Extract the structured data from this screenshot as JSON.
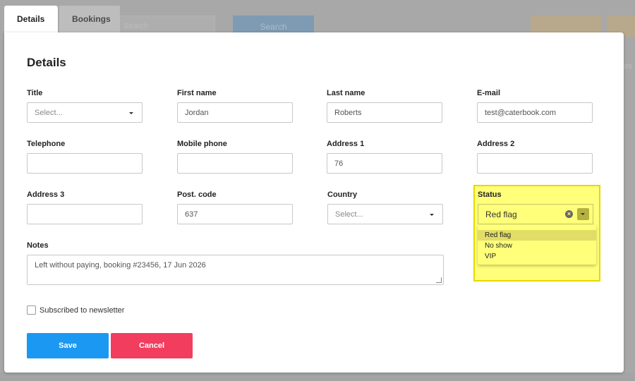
{
  "background": {
    "search_placeholder": "Search",
    "search_button": "Search",
    "side_text": "es"
  },
  "tabs": [
    {
      "label": "Details",
      "active": true
    },
    {
      "label": "Bookings",
      "active": false
    }
  ],
  "modal": {
    "title": "Details",
    "fields": {
      "title": {
        "label": "Title",
        "value": "Select...",
        "type": "select"
      },
      "first_name": {
        "label": "First name",
        "value": "Jordan"
      },
      "last_name": {
        "label": "Last name",
        "value": "Roberts"
      },
      "email": {
        "label": "E-mail",
        "value": "test@caterbook.com"
      },
      "telephone": {
        "label": "Telephone",
        "value": ""
      },
      "mobile": {
        "label": "Mobile phone",
        "value": ""
      },
      "address1": {
        "label": "Address 1",
        "value": "76"
      },
      "address2": {
        "label": "Address 2",
        "value": ""
      },
      "address3": {
        "label": "Address 3",
        "value": ""
      },
      "postcode": {
        "label": "Post. code",
        "value": "637"
      },
      "country": {
        "label": "Country",
        "value": "Select...",
        "type": "select"
      },
      "status": {
        "label": "Status",
        "value": "Red flag",
        "options": [
          "Red flag",
          "No show",
          "VIP"
        ]
      }
    },
    "notes": {
      "label": "Notes",
      "value": "Left without paying, booking #23456, 17 Jun 2026"
    },
    "newsletter": {
      "label": "Subscribed to newsletter",
      "checked": false
    },
    "buttons": {
      "save": "Save",
      "cancel": "Cancel"
    }
  },
  "colors": {
    "save": "#1a98f2",
    "cancel": "#f23d5f",
    "highlight": "#ffff7a"
  }
}
